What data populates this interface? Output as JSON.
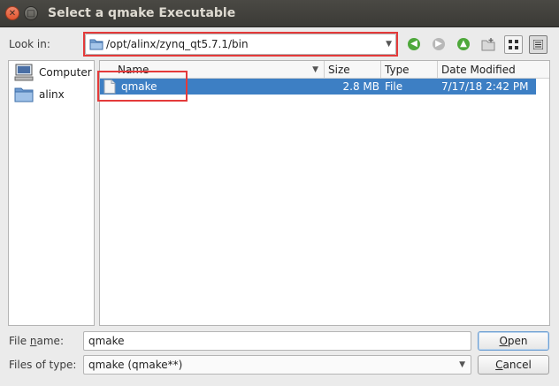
{
  "window": {
    "title": "Select a qmake Executable"
  },
  "lookin": {
    "label": "Look in:",
    "path": "/opt/alinx/zynq_qt5.7.1/bin"
  },
  "toolbar": {
    "back_icon": "back-arrow-icon",
    "forward_icon": "forward-arrow-icon",
    "up_icon": "up-arrow-icon",
    "new_folder_icon": "new-folder-icon",
    "list_view_icon": "detail-view-icon",
    "detail_view_icon": "list-view-icon"
  },
  "sidebar": {
    "items": [
      {
        "label": "Computer",
        "icon": "computer-icon"
      },
      {
        "label": "alinx",
        "icon": "folder-icon"
      }
    ]
  },
  "filelist": {
    "columns": [
      "Name",
      "Size",
      "Type",
      "Date Modified"
    ],
    "rows": [
      {
        "name": "qmake",
        "size": "2.8 MB",
        "type": "File",
        "date": "7/17/18 2:42 PM",
        "selected": true
      }
    ]
  },
  "bottom": {
    "filename_label_pre": "File ",
    "filename_label_u": "n",
    "filename_label_post": "ame:",
    "filename_value": "qmake",
    "filetype_label": "Files of type:",
    "filetype_value": "qmake (qmake**)",
    "open_label_u": "O",
    "open_label_rest": "pen",
    "cancel_label_u": "C",
    "cancel_label_rest": "ancel"
  },
  "colors": {
    "selection": "#3d7fc4",
    "highlight_box": "#e43a3a",
    "titlebar": "#3b3a36"
  }
}
